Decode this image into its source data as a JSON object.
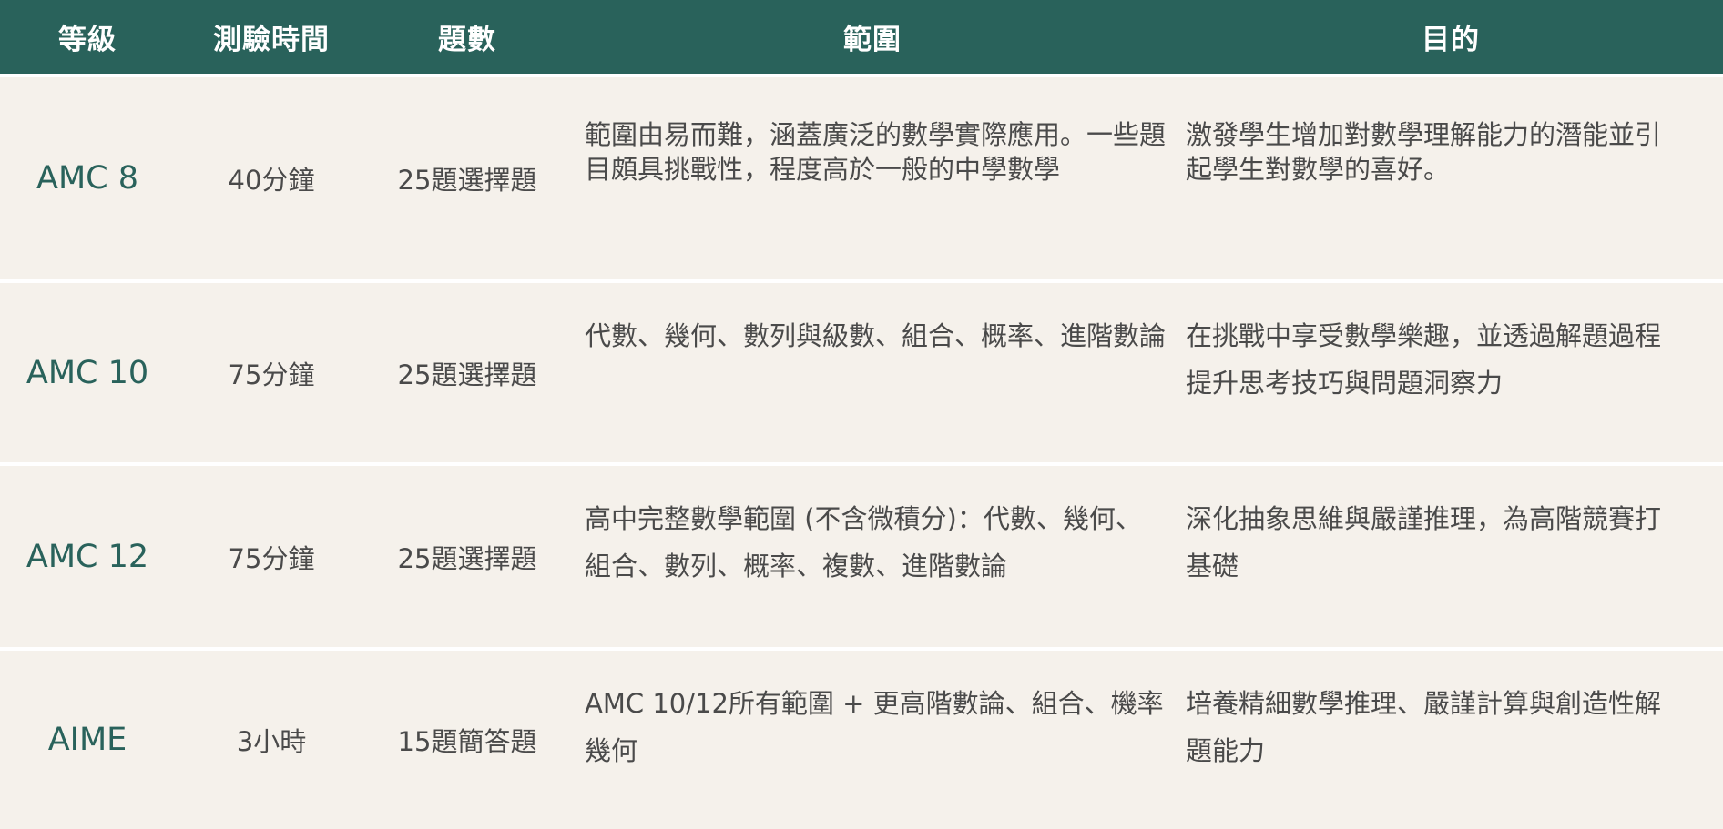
{
  "table": {
    "headers": [
      "等級",
      "測驗時間",
      "題數",
      "範圍",
      "目的"
    ],
    "rows": [
      {
        "level": "AMC 8",
        "time": "40分鐘",
        "count": "25題選擇題",
        "scope": "範圍由易而難，涵蓋廣泛的數學實際應用。一些題目頗具挑戰性，程度高於一般的中學數學",
        "goal": "激發學生增加對數學理解能力的潛能並引起學生對數學的喜好。"
      },
      {
        "level": "AMC 10",
        "time": "75分鐘",
        "count": "25題選擇題",
        "scope": "代數、幾何、數列與級數、組合、概率、進階數論",
        "goal": "在挑戰中享受數學樂趣，並透過解題過程提升思考技巧與問題洞察力"
      },
      {
        "level": "AMC 12",
        "time": "75分鐘",
        "count": "25題選擇題",
        "scope": "高中完整數學範圍 (不含微積分)：代數、幾何、組合、數列、概率、複數、進階數論",
        "goal": "深化抽象思維與嚴謹推理，為高階競賽打基礎"
      },
      {
        "level": "AIME",
        "time": "3小時",
        "count": "15題簡答題",
        "scope": "AMC 10/12所有範圍 + 更高階數論、組合、機率幾何",
        "goal": "培養精細數學推理、嚴謹計算與創造性解題能力"
      }
    ]
  },
  "colors": {
    "header_bg": "#29625b",
    "header_text": "#ffffff",
    "row_bg": "#f5f1eb",
    "level_text": "#29625b",
    "body_text": "#4a4a4a"
  }
}
